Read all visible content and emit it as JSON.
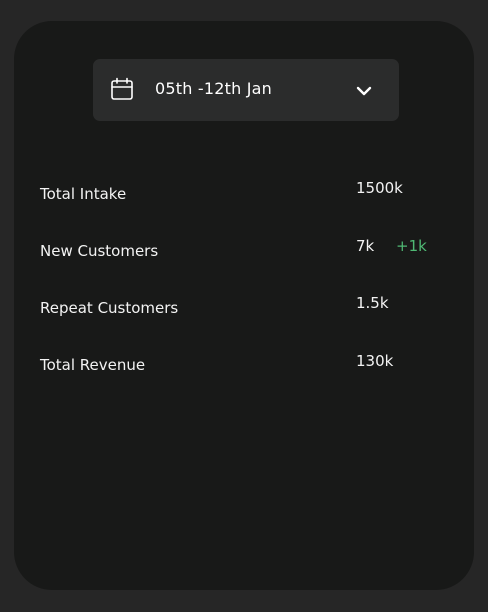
{
  "date_picker": {
    "label": "05th -12th Jan",
    "calendar_icon": "calendar-icon",
    "dropdown_icon": "chevron-down-icon"
  },
  "stats": [
    {
      "label": "Total Intake",
      "value": "1500k"
    },
    {
      "label": "New Customers",
      "value": "7k",
      "change": "+1k"
    },
    {
      "label": "Repeat Customers",
      "value": "1.5k"
    },
    {
      "label": "Total Revenue",
      "value": "130k"
    }
  ],
  "colors": {
    "page_background": "#262626",
    "card_background": "#181918",
    "picker_background": "#2b2c2c",
    "positive_change": "#4fb974",
    "text": "#f3f3f3"
  }
}
